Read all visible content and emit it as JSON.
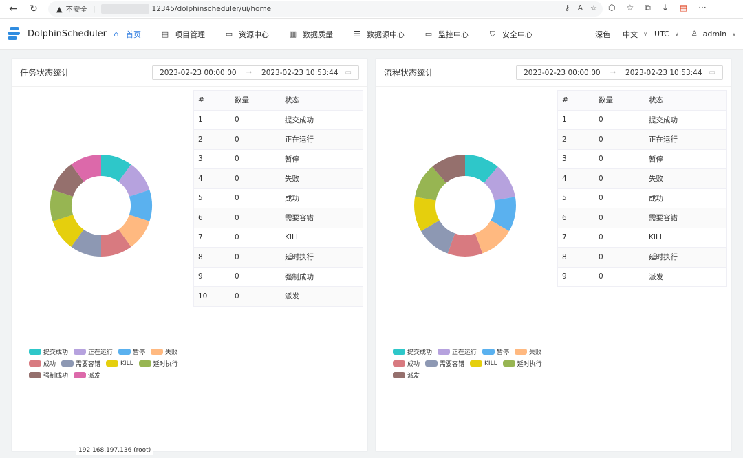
{
  "browser": {
    "security_label": "不安全",
    "url": "12345/dolphinscheduler/ui/home"
  },
  "app": {
    "logo_text": "DolphinScheduler",
    "menu": [
      {
        "label": "首页",
        "icon": "home-icon",
        "active": true
      },
      {
        "label": "项目管理",
        "icon": "project-icon",
        "active": false
      },
      {
        "label": "资源中心",
        "icon": "folder-icon",
        "active": false
      },
      {
        "label": "数据质量",
        "icon": "document-icon",
        "active": false
      },
      {
        "label": "数据源中心",
        "icon": "database-icon",
        "active": false
      },
      {
        "label": "监控中心",
        "icon": "monitor-icon",
        "active": false
      },
      {
        "label": "安全中心",
        "icon": "shield-icon",
        "active": false
      }
    ],
    "theme_label": "深色",
    "language_label": "中文",
    "timezone_label": "UTC",
    "user_label": "admin"
  },
  "colors": {
    "accent": "#2f7de1",
    "slices": [
      "#2ec7c9",
      "#b6a2de",
      "#5ab1ef",
      "#ffb980",
      "#d87a80",
      "#8d98b3",
      "#e5cf0d",
      "#97b552",
      "#95706d",
      "#dc69aa"
    ]
  },
  "task_panel": {
    "title": "任务状态统计",
    "date_start": "2023-02-23 00:00:00",
    "date_end": "2023-02-23 10:53:44",
    "headers": [
      "#",
      "数量",
      "状态"
    ],
    "rows": [
      [
        "1",
        "0",
        "提交成功"
      ],
      [
        "2",
        "0",
        "正在运行"
      ],
      [
        "3",
        "0",
        "暂停"
      ],
      [
        "4",
        "0",
        "失败"
      ],
      [
        "5",
        "0",
        "成功"
      ],
      [
        "6",
        "0",
        "需要容错"
      ],
      [
        "7",
        "0",
        "KILL"
      ],
      [
        "8",
        "0",
        "延时执行"
      ],
      [
        "9",
        "0",
        "强制成功"
      ],
      [
        "10",
        "0",
        "派发"
      ]
    ],
    "legend": [
      "提交成功",
      "正在运行",
      "暂停",
      "失败",
      "成功",
      "需要容错",
      "KILL",
      "延时执行",
      "强制成功",
      "派发"
    ]
  },
  "process_panel": {
    "title": "流程状态统计",
    "date_start": "2023-02-23 00:00:00",
    "date_end": "2023-02-23 10:53:44",
    "headers": [
      "#",
      "数量",
      "状态"
    ],
    "rows": [
      [
        "1",
        "0",
        "提交成功"
      ],
      [
        "2",
        "0",
        "正在运行"
      ],
      [
        "3",
        "0",
        "暂停"
      ],
      [
        "4",
        "0",
        "失败"
      ],
      [
        "5",
        "0",
        "成功"
      ],
      [
        "6",
        "0",
        "需要容错"
      ],
      [
        "7",
        "0",
        "KILL"
      ],
      [
        "8",
        "0",
        "延时执行"
      ],
      [
        "9",
        "0",
        "派发"
      ]
    ],
    "legend": [
      "提交成功",
      "正在运行",
      "暂停",
      "失败",
      "成功",
      "需要容错",
      "KILL",
      "延时执行",
      "派发"
    ]
  },
  "chart_data": [
    {
      "type": "pie",
      "categories": [
        "提交成功",
        "正在运行",
        "暂停",
        "失败",
        "成功",
        "需要容错",
        "KILL",
        "延时执行",
        "强制成功",
        "派发"
      ],
      "values": [
        0,
        0,
        0,
        0,
        0,
        0,
        0,
        0,
        0,
        0
      ]
    },
    {
      "type": "pie",
      "categories": [
        "提交成功",
        "正在运行",
        "暂停",
        "失败",
        "成功",
        "需要容错",
        "KILL",
        "延时执行",
        "派发"
      ],
      "values": [
        0,
        0,
        0,
        0,
        0,
        0,
        0,
        0,
        0
      ]
    }
  ],
  "status_bar": {
    "text": "192.168.197.136 (root)"
  }
}
